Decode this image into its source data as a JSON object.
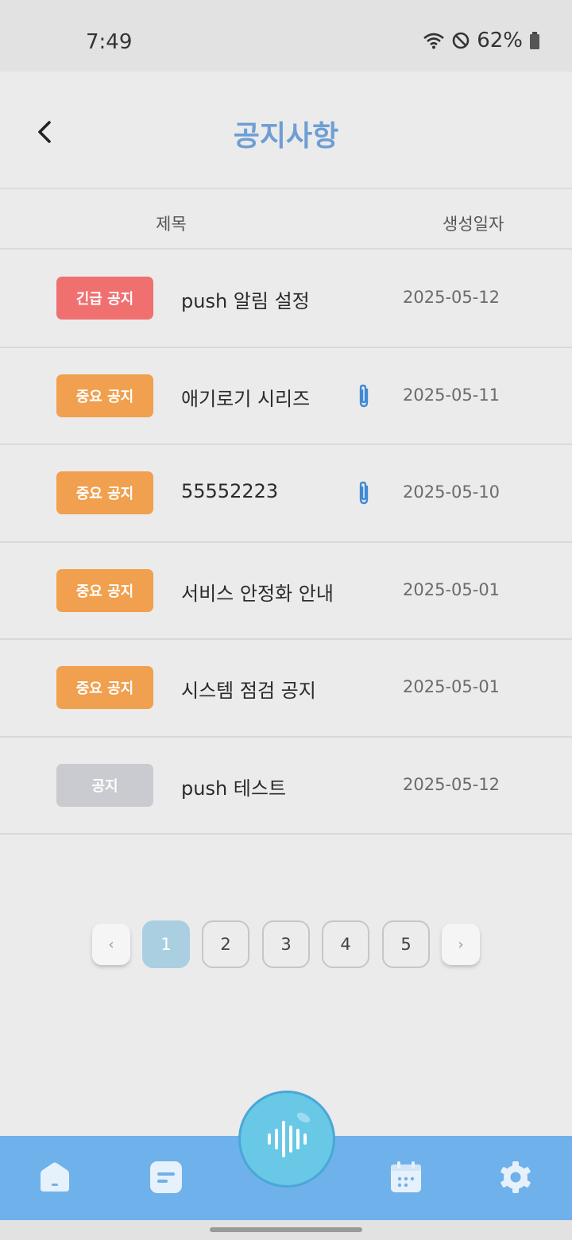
{
  "status_bar": {
    "time": "7:49",
    "battery": "62%"
  },
  "header": {
    "title": "공지사항"
  },
  "table": {
    "col_title": "제목",
    "col_date": "생성일자",
    "rows": [
      {
        "badge": "긴급 공지",
        "badge_color": "#f07070",
        "title": "push 알림 설정",
        "has_attachment": false,
        "date": "2025-05-12"
      },
      {
        "badge": "중요 공지",
        "badge_color": "#f0a04e",
        "title": "애기로기 시리즈",
        "has_attachment": true,
        "date": "2025-05-11"
      },
      {
        "badge": "중요 공지",
        "badge_color": "#f0a04e",
        "title": "55552223",
        "has_attachment": true,
        "date": "2025-05-10"
      },
      {
        "badge": "중요 공지",
        "badge_color": "#f0a04e",
        "title": "서비스 안정화 안내",
        "has_attachment": false,
        "date": "2025-05-01"
      },
      {
        "badge": "중요 공지",
        "badge_color": "#f0a04e",
        "title": "시스템 점검 공지",
        "has_attachment": false,
        "date": "2025-05-01"
      },
      {
        "badge": "공지",
        "badge_color": "#c9cbd0",
        "title": "push 테스트",
        "has_attachment": false,
        "date": "2025-05-12"
      }
    ]
  },
  "pagination": {
    "prev": "‹",
    "next": "›",
    "pages": [
      "1",
      "2",
      "3",
      "4",
      "5"
    ],
    "current": "1"
  },
  "bottom_nav": {
    "items": [
      "home-icon",
      "board-icon",
      "voice-record-icon",
      "calendar-icon",
      "settings-icon"
    ]
  },
  "colors": {
    "accent": "#6e9ed4",
    "nav_bg": "#6fb1ea",
    "fab": "#68c8e6"
  }
}
